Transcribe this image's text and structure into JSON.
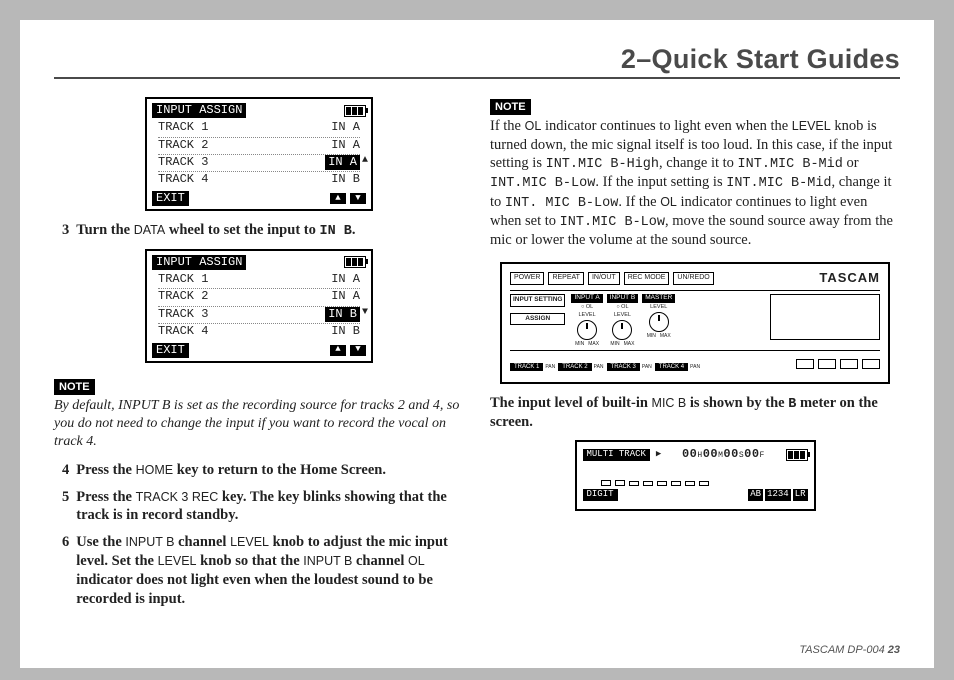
{
  "page_title": "2–Quick Start Guides",
  "lcd_common": {
    "header": "INPUT ASSIGN",
    "tracks": [
      "TRACK 1",
      "TRACK 2",
      "TRACK 3",
      "TRACK 4"
    ],
    "exit": "EXIT"
  },
  "lcd1": {
    "values": [
      "IN A",
      "IN A",
      "IN A",
      "IN B"
    ],
    "selected_index": 2,
    "side_arrow": "▲"
  },
  "lcd2": {
    "values": [
      "IN A",
      "IN A",
      "IN B",
      "IN B"
    ],
    "selected_index": 2,
    "side_arrow": "▼"
  },
  "left": {
    "step3_pre": "Turn the ",
    "step3_tok1": "DATA",
    "step3_mid": " wheel to set the input to ",
    "step3_tok2": "IN B",
    "step3_post": ".",
    "note_tag": "NOTE",
    "note_text": "By default, INPUT B is set as the recording source for tracks 2 and 4, so you do not need to change the input if you want to record the vocal on track 4.",
    "step4_a": "Press the ",
    "step4_b": "HOME",
    "step4_c": " key to return to the Home Screen.",
    "step5_a": "Press the ",
    "step5_b": "TRACK 3 REC",
    "step5_c": " key. The key blinks showing that the track is in record standby.",
    "step6_a": "Use the ",
    "step6_b": "INPUT B",
    "step6_c": " channel ",
    "step6_d": "LEVEL",
    "step6_e": " knob to adjust the mic input level. Set the ",
    "step6_f": "LEVEL",
    "step6_g": " knob so that the ",
    "step6_h": "INPUT B",
    "step6_i": " channel ",
    "step6_j": "OL",
    "step6_k": " indicator does not light even when the loudest sound to be recorded is input."
  },
  "right": {
    "note_tag": "NOTE",
    "p1_a": "If the ",
    "p1_b": "OL",
    "p1_c": " indicator continues to light even when the ",
    "p1_d": "LEVEL",
    "p1_e": " knob is turned down, the mic signal itself is too loud. In this case, if the input setting is ",
    "p1_f": "INT.MIC B-High",
    "p1_g": ", change it to ",
    "p1_h": "INT.MIC B-Mid",
    "p1_i": " or ",
    "p1_j": "INT.MIC B-Low",
    "p1_k": ". If the input setting is ",
    "p1_l": "INT.MIC B-Mid",
    "p1_m": ", change it to ",
    "p1_n": "INT. MIC B-Low",
    "p1_o": ". If the ",
    "p1_p": "OL",
    "p1_q": " indicator continues to light even when set to ",
    "p1_r": "INT.MIC B-Low",
    "p1_s": ", move the sound source away from the mic or lower the volume at the sound source."
  },
  "device": {
    "buttons": [
      "POWER",
      "REPEAT",
      "IN/OUT",
      "REC MODE",
      "UN/REDO"
    ],
    "brand": "TASCAM",
    "left_labels": [
      "INPUT SETTING",
      "ASSIGN"
    ],
    "knob_headers": [
      "INPUT A",
      "INPUT B",
      "MASTER"
    ],
    "level": "LEVEL",
    "ol": "OL",
    "min": "MIN",
    "max": "MAX",
    "tracks": [
      "TRACK 1",
      "TRACK 2",
      "TRACK 3",
      "TRACK 4"
    ],
    "pan": "PAN"
  },
  "bottom_bold_a": "The input level of built-in ",
  "bottom_bold_b": "MIC B",
  "bottom_bold_c": " is shown by the ",
  "bottom_bold_d": "B",
  "bottom_bold_e": " meter on the screen.",
  "meter_lcd": {
    "top_left": "MULTI TRACK",
    "play": "▶",
    "counter_h": "00",
    "counter_m": "00",
    "counter_s": "00",
    "counter_f": "00",
    "h": "H",
    "m": "M",
    "s": "S",
    "f": "F",
    "digit": "DIGIT",
    "ab": "AB",
    "n1234": "1234",
    "lr": "LR"
  },
  "footer_model": "TASCAM  DP-004",
  "footer_page": "23"
}
